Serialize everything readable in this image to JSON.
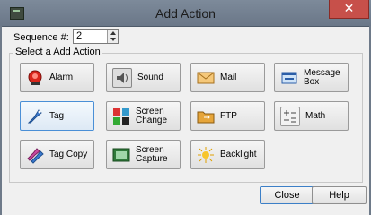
{
  "window": {
    "title": "Add Action",
    "close_glyph": "✕"
  },
  "sequence": {
    "label": "Sequence #:",
    "value": "2"
  },
  "group_label": "Select a Add Action",
  "actions": [
    {
      "label": "Alarm",
      "icon": "alarm-icon"
    },
    {
      "label": "Sound",
      "icon": "speaker-icon"
    },
    {
      "label": "Mail",
      "icon": "envelope-icon"
    },
    {
      "label": "Message Box",
      "icon": "message-box-icon"
    },
    {
      "label": "Tag",
      "icon": "tag-icon",
      "selected": true
    },
    {
      "label": "Screen\nChange",
      "icon": "screen-change-icon"
    },
    {
      "label": "FTP",
      "icon": "folder-icon"
    },
    {
      "label": "Math",
      "icon": "math-icon"
    },
    {
      "label": "Tag Copy",
      "icon": "tag-copy-icon"
    },
    {
      "label": "Screen\nCapture",
      "icon": "screen-capture-icon"
    },
    {
      "label": "Backlight",
      "icon": "backlight-icon"
    }
  ],
  "buttons": {
    "close": "Close",
    "help": "Help"
  },
  "colors": {
    "titlebar": "#6f7c8d",
    "close_button": "#c7504a",
    "selected_border": "#4a8fd6"
  }
}
